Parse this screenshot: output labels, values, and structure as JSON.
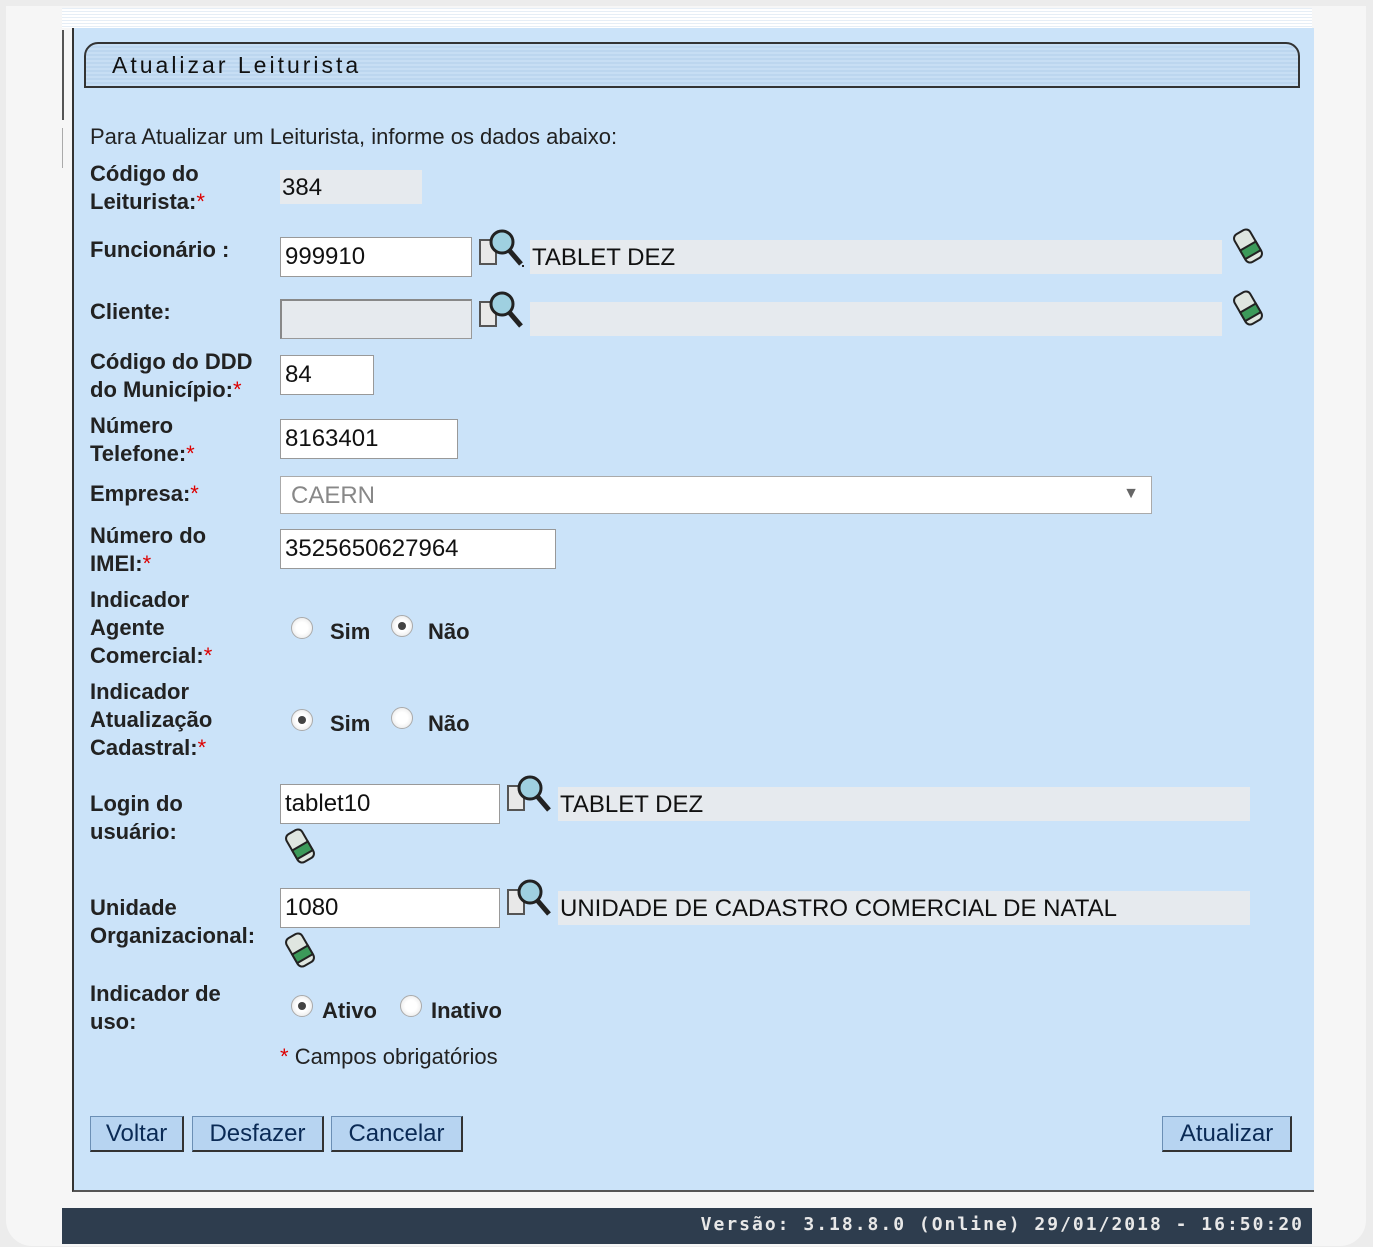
{
  "title": "Atualizar Leiturista",
  "intro": "Para Atualizar um Leiturista, informe os dados abaixo:",
  "fields": {
    "codigo": {
      "label_l1": "Código do",
      "label_l2": "Leiturista:",
      "value": "384"
    },
    "funcionario": {
      "label": "Funcionário :",
      "value": "999910",
      "description": "TABLET DEZ"
    },
    "cliente": {
      "label": "Cliente:",
      "value": "",
      "description": ""
    },
    "ddd": {
      "label_l1": "Código do DDD",
      "label_l2": "do Município:",
      "value": "84"
    },
    "telefone": {
      "label_l1": "Número",
      "label_l2": "Telefone:",
      "value": "8163401"
    },
    "empresa": {
      "label": "Empresa:",
      "value": "CAERN"
    },
    "imei": {
      "label_l1": "Número do",
      "label_l2": "IMEI:",
      "value": "3525650627964"
    },
    "agente": {
      "label_l1": "Indicador",
      "label_l2": "Agente",
      "label_l3": "Comercial:",
      "opt_sim": "Sim",
      "opt_nao": "Não",
      "selected": "Não"
    },
    "atualizacao": {
      "label_l1": "Indicador",
      "label_l2": "Atualização",
      "label_l3": "Cadastral:",
      "opt_sim": "Sim",
      "opt_nao": "Não",
      "selected": "Sim"
    },
    "login": {
      "label_l1": "Login do",
      "label_l2": "usuário:",
      "value": "tablet10",
      "description": "TABLET DEZ"
    },
    "unidade": {
      "label_l1": "Unidade",
      "label_l2": "Organizacional:",
      "value": "1080",
      "description": "UNIDADE DE CADASTRO COMERCIAL DE NATAL"
    },
    "uso": {
      "label_l1": "Indicador de",
      "label_l2": "uso:",
      "opt_ativo": "Ativo",
      "opt_inativo": "Inativo",
      "selected": "Ativo"
    }
  },
  "required_mark": "*",
  "required_note": "Campos obrigatórios",
  "buttons": {
    "voltar": "Voltar",
    "desfazer": "Desfazer",
    "cancelar": "Cancelar",
    "atualizar": "Atualizar"
  },
  "footer": "Versão: 3.18.8.0 (Online) 29/01/2018 - 16:50:20"
}
